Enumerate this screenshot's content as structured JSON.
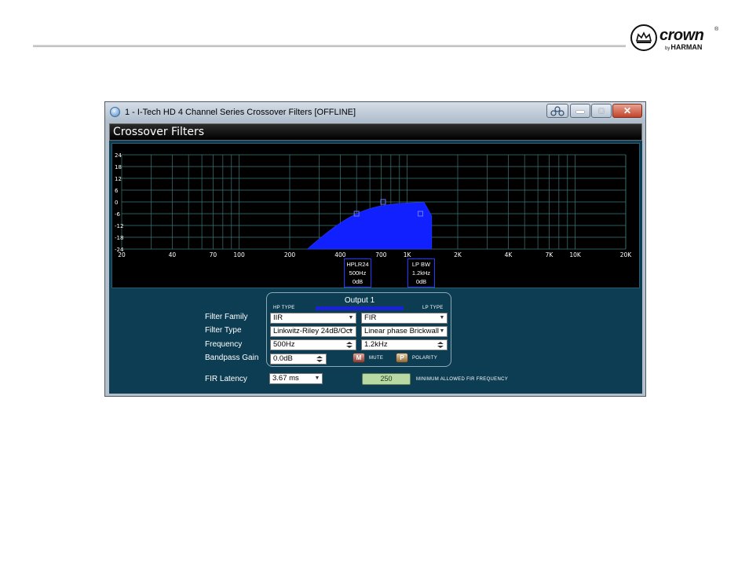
{
  "brand": {
    "name": "crown",
    "registered": "®",
    "by": "by",
    "parent": "HARMAN"
  },
  "window": {
    "title": "1 - I-Tech HD 4 Channel Series Crossover Filters [OFFLINE]",
    "buttons": {
      "minimize": "▬",
      "maximize": "□",
      "close": "✕"
    }
  },
  "panel": {
    "title": "Crossover Filters"
  },
  "graph": {
    "y_ticks": [
      "24",
      "18",
      "12",
      "6",
      "0",
      "-6",
      "-12",
      "-18",
      "-24"
    ],
    "x_ticks": [
      "20",
      "40",
      "70",
      "100",
      "200",
      "400",
      "700",
      "1K",
      "2K",
      "4K",
      "7K",
      "10K",
      "20K"
    ],
    "fill_color": "#1020ff",
    "grid_color": "#3c7a78",
    "markers": [
      {
        "line1": "HPLR24",
        "line2": "500Hz",
        "line3": "0dB"
      },
      {
        "line1": "LP BW",
        "line2": "1.2kHz",
        "line3": "0dB"
      }
    ]
  },
  "controls": {
    "output_title": "Output  1",
    "hp_type_label": "HP TYPE",
    "lp_type_label": "LP TYPE",
    "filter_family_label": "Filter Family",
    "filter_type_label": "Filter Type",
    "frequency_label": "Frequency",
    "bandpass_gain_label": "Bandpass Gain",
    "fir_latency_label": "FIR Latency",
    "hp_family": "IIR",
    "lp_family": "FIR",
    "hp_type": "Linkwitz-Riley 24dB/Oct",
    "lp_type": "Linear phase Brickwall",
    "hp_frequency": "500Hz",
    "lp_frequency": "1.2kHz",
    "bandpass_gain": "0.0dB",
    "mute_button": "M",
    "mute_label": "MUTE",
    "polarity_button": "P",
    "polarity_label": "POLARITY",
    "fir_latency": "3.67 ms",
    "min_fir_value": "250",
    "min_fir_label": "MINIMUM ALLOWED FIR FREQUENCY"
  }
}
